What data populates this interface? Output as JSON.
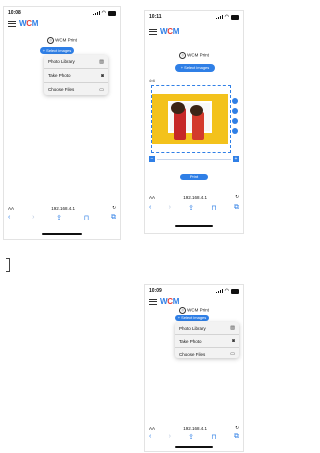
{
  "app": {
    "logo": {
      "w": "W",
      "c": "C",
      "m": "M"
    },
    "print_title": "WCM Print",
    "print_icon": "printer-icon"
  },
  "browser": {
    "text_size": "AA",
    "address": "192.168.4.1"
  },
  "colors": {
    "accent": "#2f7fe6",
    "logo_red": "#e8403a",
    "photo_bg": "#f3c21c"
  },
  "phones": {
    "a": {
      "time": "10:08",
      "select": "+ Select images",
      "menu": [
        {
          "label": "Photo Library",
          "icon": "photo-icon"
        },
        {
          "label": "Take Photo",
          "icon": "camera-icon"
        },
        {
          "label": "Choose Files",
          "icon": "folder-icon"
        }
      ]
    },
    "b": {
      "time": "10:11",
      "select": "+ Select images",
      "ratio": "4×6",
      "print": "Print"
    },
    "c": {
      "time": "10:09",
      "select": "+ Select images",
      "menu": [
        {
          "label": "Photo Library",
          "icon": "photo-icon"
        },
        {
          "label": "Take Photo",
          "icon": "camera-icon"
        },
        {
          "label": "Choose Files",
          "icon": "folder-icon"
        }
      ]
    }
  }
}
